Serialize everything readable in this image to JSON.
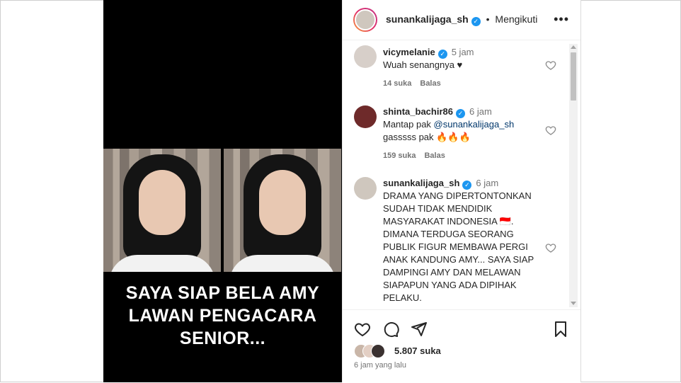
{
  "media": {
    "caption_lines": [
      "SAYA SIAP BELA AMY",
      "LAWAN PENGACARA",
      "SENIOR..."
    ]
  },
  "header": {
    "username": "sunankalijaga_sh",
    "separator": "•",
    "follow_status": "Mengikuti",
    "more_icon": "more-horizontal-icon"
  },
  "comments": [
    {
      "username": "vicymelanie",
      "time": "5 jam",
      "text": "Wuah senangnya ♥",
      "likes": "14 suka",
      "reply": "Balas"
    },
    {
      "username": "shinta_bachir86",
      "time": "6 jam",
      "text_prefix": "Mantap pak ",
      "mention": "@sunankalijaga_sh",
      "text_suffix": "gasssss pak 🔥🔥🔥",
      "likes": "159 suka",
      "reply": "Balas"
    },
    {
      "username": "sunankalijaga_sh",
      "time": "6 jam",
      "text": "DRAMA YANG DIPERTONTONKAN\nSUDAH TIDAK MENDIDIK\nMASYARAKAT INDONESIA 🇮🇩.\nDIMANA TERDUGA SEORANG\nPUBLIK FIGUR MEMBAWA PERGI\nANAK KANDUNG AMY... SAYA SIAP\nDAMPINGI AMY DAN MELAWAN\nSIAPAPUN YANG ADA DIPIHAK\nPELAKU."
    }
  ],
  "post": {
    "likes": "5.807 suka",
    "time_ago": "6 jam yang lalu"
  },
  "colors": {
    "verified": "#1c96f0",
    "mention": "#00376b",
    "muted": "#737373"
  }
}
